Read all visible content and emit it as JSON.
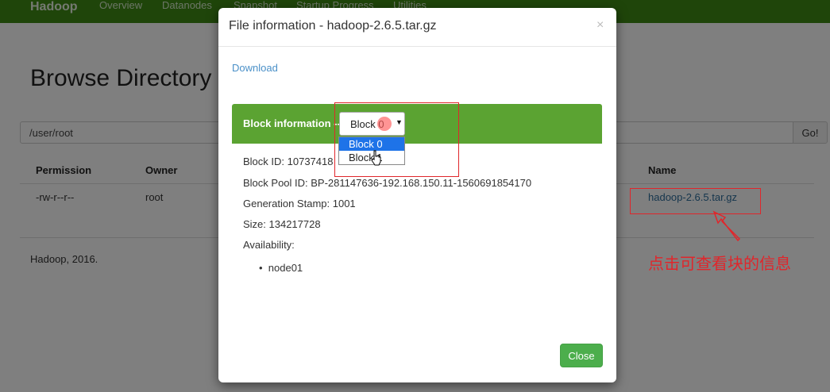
{
  "navbar": {
    "brand": "Hadoop",
    "items": [
      "Overview",
      "Datanodes",
      "Snapshot",
      "Startup Progress",
      "Utilities"
    ]
  },
  "page": {
    "title": "Browse Directory",
    "path_value": "/user/root",
    "go_label": "Go!",
    "table": {
      "headers": [
        "Permission",
        "Owner",
        "Name"
      ],
      "rows": [
        [
          "-rw-r--r--",
          "root",
          "hadoop-2.6.5.tar.gz"
        ]
      ]
    },
    "footer": "Hadoop, 2016."
  },
  "modal": {
    "title": "File information - hadoop-2.6.5.tar.gz",
    "close_glyph": "×",
    "download_label": "Download",
    "panel_heading": "Block information --",
    "select": {
      "value": "Block 0",
      "options": [
        "Block 0",
        "Block 1"
      ]
    },
    "block_id": "Block ID: 10737418",
    "block_pool_id": "Block Pool ID: BP-281147636-192.168.150.11-1560691854170",
    "generation_stamp": "Generation Stamp: 1001",
    "size": "Size: 134217728",
    "availability_label": "Availability:",
    "nodes": [
      "node01"
    ],
    "close_label": "Close"
  },
  "annotation": {
    "text": "点击可查看块的信息",
    "color": "#e0262b"
  },
  "colors": {
    "navbar": "#3e8a15",
    "panel_heading": "#5ba332",
    "close_button": "#4cae4c",
    "dropdown_selected": "#1e73e8",
    "link": "#4a90c8"
  }
}
